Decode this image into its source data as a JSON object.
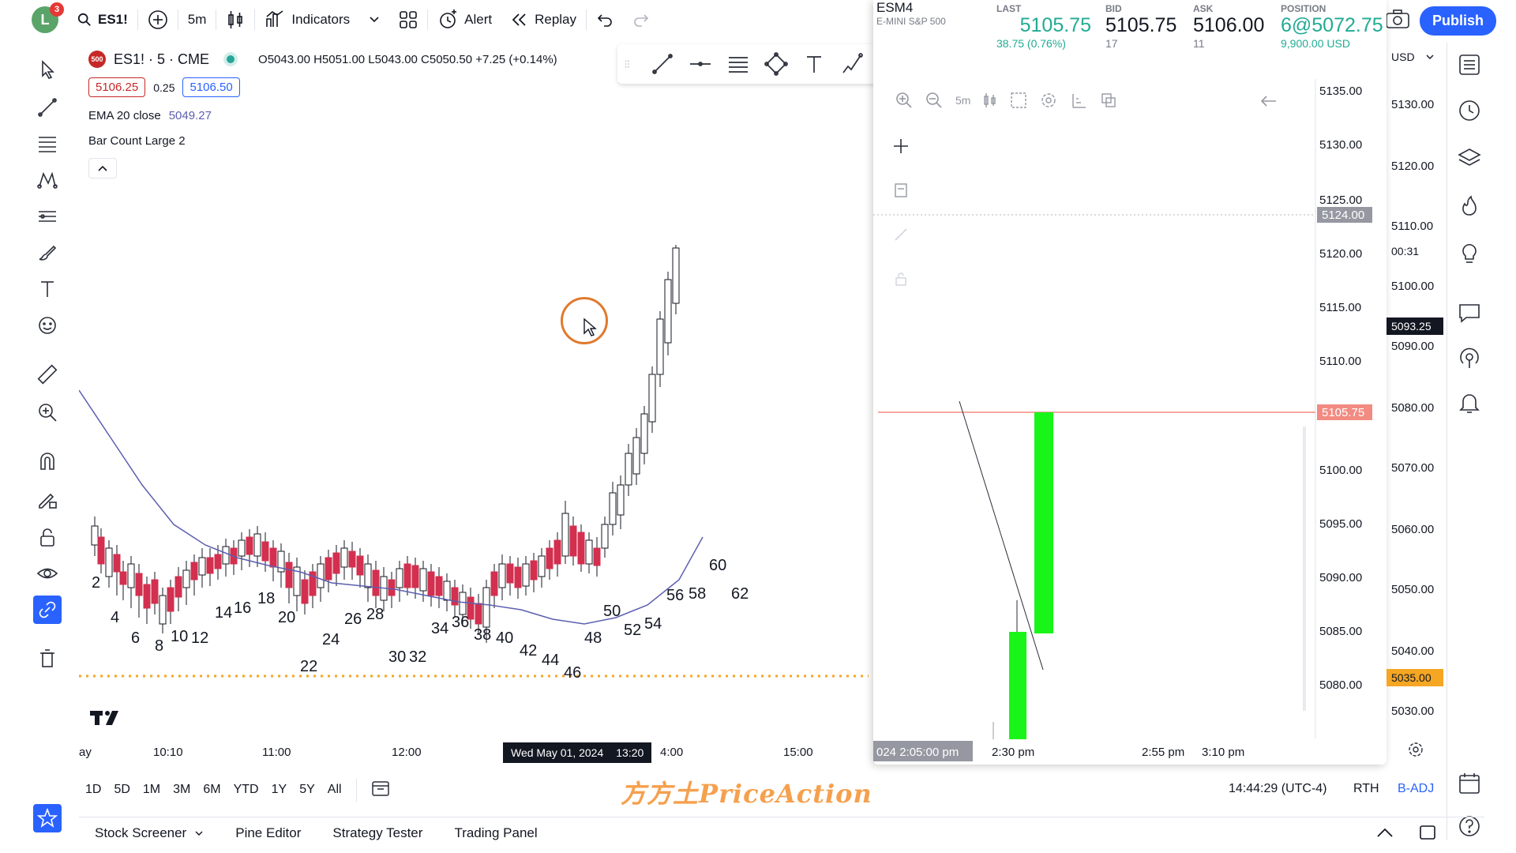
{
  "topbar": {
    "avatar_letter": "L",
    "notif_count": "3",
    "symbol": "ES1!",
    "interval": "5m",
    "indicators_label": "Indicators",
    "alert_label": "Alert",
    "replay_label": "Replay",
    "publish_label": "Publish"
  },
  "legend": {
    "logo_text": "500",
    "title": "ES1! · 5 · CME",
    "ohlc": "O5043.00 H5051.00 L5043.00 C5050.50 +7.25 (+0.14%)",
    "bid": "5106.25",
    "spread": "0.25",
    "ask": "5106.50",
    "ema_label": "EMA 20 close",
    "ema_value": "5049.27",
    "barcount_label": "Bar Count Large 2"
  },
  "bar_numbers": [
    {
      "n": "2"
    },
    {
      "n": "4"
    },
    {
      "n": "6"
    },
    {
      "n": "8"
    },
    {
      "n": "10"
    },
    {
      "n": "12"
    },
    {
      "n": "14"
    },
    {
      "n": "16"
    },
    {
      "n": "18"
    },
    {
      "n": "20"
    },
    {
      "n": "22"
    },
    {
      "n": "24"
    },
    {
      "n": "26"
    },
    {
      "n": "28"
    },
    {
      "n": "30"
    },
    {
      "n": "32"
    },
    {
      "n": "34"
    },
    {
      "n": "36"
    },
    {
      "n": "38"
    },
    {
      "n": "40"
    },
    {
      "n": "42"
    },
    {
      "n": "44"
    },
    {
      "n": "46"
    },
    {
      "n": "48"
    },
    {
      "n": "50"
    },
    {
      "n": "52"
    },
    {
      "n": "54"
    },
    {
      "n": "56"
    },
    {
      "n": "58"
    },
    {
      "n": "60"
    },
    {
      "n": "62"
    }
  ],
  "time_axis": {
    "labels": [
      "ay",
      "10:10",
      "11:00",
      "12:00",
      "4:00",
      "15:00"
    ],
    "crosshair": "Wed May 01, 2024",
    "crosshair_time": "13:20"
  },
  "popup": {
    "symbol": "ESM4",
    "desc": "E-MINI S&P 500",
    "last_label": "LAST",
    "last": "5105.75",
    "last_change": "38.75 (0.76%)",
    "bid_label": "BID",
    "bid": "5105.75",
    "bid_size": "17",
    "ask_label": "ASK",
    "ask": "5106.00",
    "ask_size": "11",
    "pos_label": "POSITION",
    "pos": "6@5072.75",
    "pos_value": "9,900.00 USD",
    "interval": "5m",
    "scale": [
      "5135.00",
      "5130.00",
      "5125.00",
      "5120.00",
      "5115.00",
      "5110.00",
      "5105.00",
      "5100.00",
      "5095.00",
      "5090.00",
      "5085.00",
      "5080.00"
    ],
    "tag_1": "5124.00",
    "tag_2": "5105.75",
    "time_labels": [
      "024 2:05:00 pm",
      "2:30 pm",
      "2:55 pm",
      "3:10 pm"
    ]
  },
  "right_scale": {
    "currency": "USD",
    "labels": [
      "5130.00",
      "5120.00",
      "5110.00",
      "5100.00",
      "5090.00",
      "5080.00",
      "5070.00",
      "5060.00",
      "5050.00",
      "5040.00",
      "5030.00"
    ],
    "countdown": "00:31",
    "price_tag": "5093.25",
    "level_tag": "5035.00"
  },
  "range": {
    "buttons": [
      "1D",
      "5D",
      "1M",
      "3M",
      "6M",
      "YTD",
      "1Y",
      "5Y",
      "All"
    ],
    "watermark": "方方土PriceAction",
    "clock": "14:44:29 (UTC-4)",
    "session": "RTH",
    "adj": "B-ADJ"
  },
  "bottom": {
    "tabs": [
      "Stock Screener",
      "Pine Editor",
      "Strategy Tester",
      "Trading Panel"
    ]
  },
  "colors": {
    "up": "#ffffff",
    "down": "#d32f4f",
    "ema": "#5c5fb0",
    "accent": "#2962ff",
    "popup_green": "#19f519"
  }
}
